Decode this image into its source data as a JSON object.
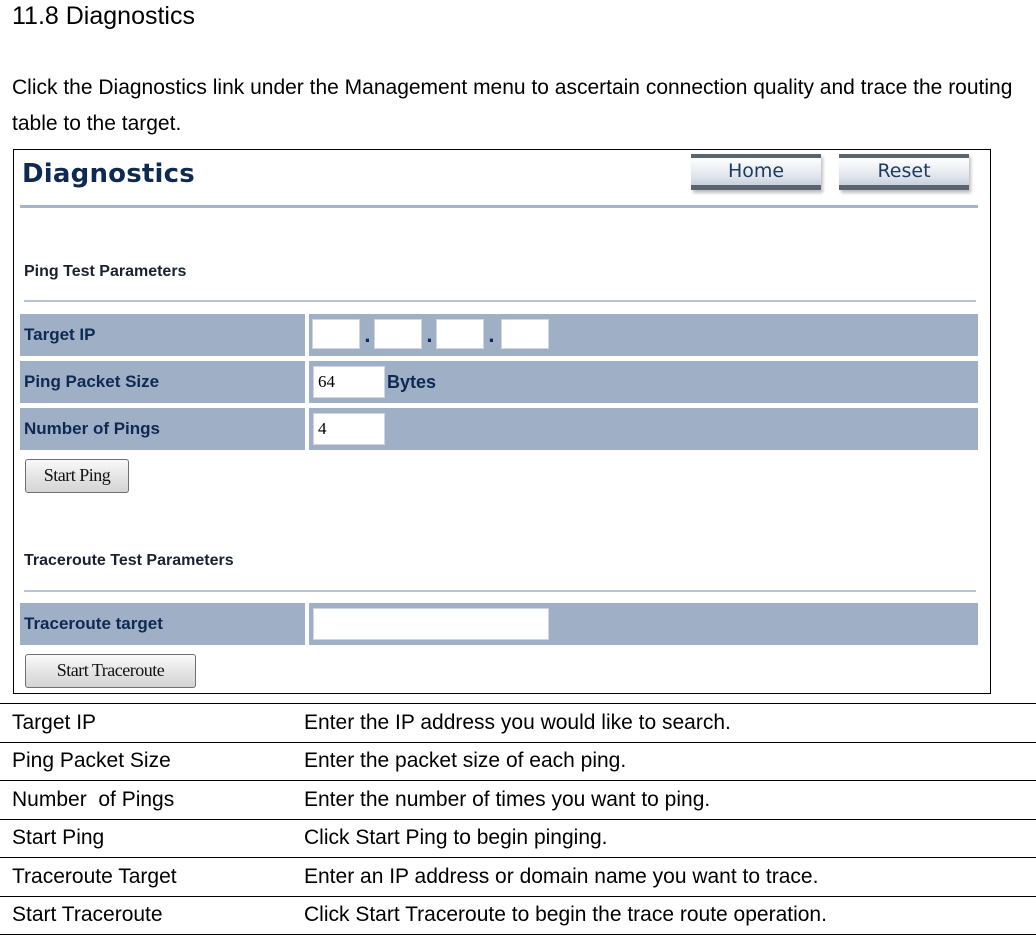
{
  "doc": {
    "heading": "11.8 Diagnostics",
    "intro": "Click the Diagnostics link under the Management menu to ascertain connection quality and trace the routing table to the target."
  },
  "screenshot": {
    "title": "Diagnostics",
    "buttons": {
      "home": "Home",
      "reset": "Reset"
    },
    "ping_section": {
      "title": "Ping Test Parameters",
      "rows": [
        {
          "label": "Target IP",
          "octets": [
            "",
            "",
            "",
            ""
          ],
          "separator": "."
        },
        {
          "label": "Ping Packet Size",
          "value": "64",
          "unit": "Bytes"
        },
        {
          "label": "Number of Pings",
          "value": "4"
        }
      ],
      "start_button": "Start Ping"
    },
    "traceroute_section": {
      "title": "Traceroute Test Parameters",
      "rows": [
        {
          "label": "Traceroute target",
          "value": ""
        }
      ],
      "start_button": "Start Traceroute"
    },
    "colors": {
      "title_text": "#0e2a52",
      "row_background": "#9eafc6",
      "divider": "#a3b4cc"
    }
  },
  "description_table": [
    {
      "term": "Target IP",
      "description": "Enter the IP address you would like to search."
    },
    {
      "term": "Ping Packet Size",
      "description": "Enter the packet size of each ping."
    },
    {
      "term": "Number  of Pings",
      "description": "Enter the number of times you want to ping."
    },
    {
      "term": "Start Ping",
      "description": "Click Start Ping to begin pinging."
    },
    {
      "term": "Traceroute Target",
      "description": "Enter an IP address or domain name you want to trace."
    },
    {
      "term": "Start Traceroute",
      "description": "Click Start Traceroute to begin the trace route operation."
    }
  ]
}
